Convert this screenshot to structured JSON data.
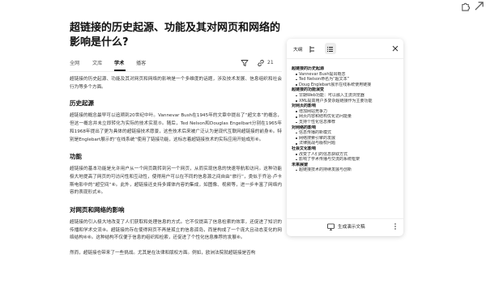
{
  "article": {
    "title": "超链接的历史起源、功能及其对网页和网络的影响是什么?",
    "tabs": [
      {
        "label": "全网"
      },
      {
        "label": "文库"
      },
      {
        "label": "学术"
      },
      {
        "label": "播客"
      }
    ],
    "active_tab": "学术",
    "link_count": "21",
    "paragraphs": {
      "intro": "超链接的历史起源、功能及其对网页和网络的影响是一个多维度的话题，涉及技术发展、信息组织和社会行为等多个方面。",
      "h_origin": "历史起源",
      "origin": "超链接的概念最早可以追溯到20世纪中叶。Vannevar Bush在1945年的文章中提出了“超文本”的概念，但这一概念并未立即转化为实际的技术实现⑤。随后，Ted Nelson和Douglas Engelbart分别在1965年和1968年提出了更为具体的超链接技术愿景，这些技术后来被广泛认为是现代互联网超链接的前身⑧。特别是Englebart展示的“在线系统”使用了链接功能，这标志着超链接技术的实际应用开始成形⑧。",
      "h_function": "功能",
      "function": "超链接的基本功能是允许用户从一个网页跳转到另一个网页，从而实现信息的快速导航和访问。这种功能极大地提高了网页的可访问性和互动性，使得用户可以在不同的信息源之间自由“旅行”，类似于乔治·卢卡斯电影中的“超空间”⑧。此外，超链接还支持多媒体内容的集成，如图像、视频等，进一步丰富了网络内容的表现形式⑧。",
      "h_impact": "对网页和网络的影响",
      "impact": "超链接的引入极大地改变了人们获取和处理信息的方式。它不仅提高了信息检索的效率，还促进了知识的传播和学术交流⑧。超链接的存在使得网页不再是孤立的信息孤岛，而是构成了一个庞大且动态变化的网络结构⑧⑧。这种结构不仅便于信息的组织和检索，还促进了个性化信息推荐的发展⑧。",
      "tail": "然而，超链接也带来了一些挑战。尤其是在法律和版权方面。例如，欧洲法院就超链接是否构"
    }
  },
  "panel": {
    "tab_outline": "大纲",
    "sections": [
      {
        "title": "超链接的历史起源",
        "items": [
          "Vannevar Bush提出概念",
          "Ted Nelson命名为“超文本”",
          "Doug Englebart展示在线系统使用链接"
        ]
      },
      {
        "title": "超链接的功能演变",
        "items": [
          "早期Web功能：可以融入主流浏览器",
          "XML提高用户多复杂超链接作为主要功能"
        ]
      },
      {
        "title": "对网页的影响",
        "items": [
          "增加网站竞争力",
          "网页内容和结构优化访问能量",
          "支持个性化信息推荐"
        ]
      },
      {
        "title": "对网络的影响",
        "items": [
          "信息传播的新模式",
          "网络搜索引擎的发展",
          "法律挑战与版权问题"
        ]
      },
      {
        "title": "社会文化影响",
        "items": [
          "改变了人们的信息获取方式",
          "影响了学术传播与交流的系统框架"
        ]
      },
      {
        "title": "未来展望",
        "items": [
          "超链接技术的持续发展与创新"
        ]
      }
    ],
    "generate_label": "生成演示文稿"
  }
}
